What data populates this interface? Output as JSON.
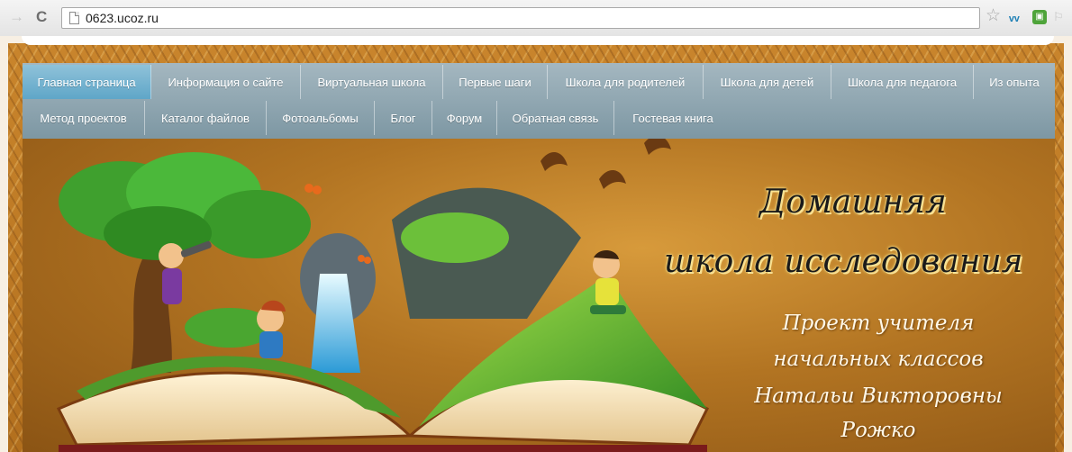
{
  "browser": {
    "url": "0623.ucoz.ru"
  },
  "menu": {
    "row1": [
      {
        "label": "Главная страница",
        "active": true
      },
      {
        "label": "Информация о сайте"
      },
      {
        "label": "Виртуальная школа"
      },
      {
        "label": "Первые шаги"
      },
      {
        "label": "Школа для родителей"
      },
      {
        "label": "Школа для детей"
      },
      {
        "label": "Школа для педагога"
      },
      {
        "label": "Из опыта"
      }
    ],
    "row2": [
      {
        "label": "Метод проектов"
      },
      {
        "label": "Каталог файлов"
      },
      {
        "label": "Фотоальбомы"
      },
      {
        "label": "Блог"
      },
      {
        "label": "Форум"
      },
      {
        "label": "Обратная связь"
      },
      {
        "label": "Гостевая книга"
      }
    ]
  },
  "banner": {
    "title_line1": "Домашняя",
    "title_line2": "школа исследования",
    "subtitle_line1": "Проект учителя",
    "subtitle_line2": "начальных классов",
    "subtitle_line3": "Натальи Викторовны",
    "subtitle_line4": "Рожко"
  },
  "colors": {
    "menu": "#8ea6b1",
    "menu_active": "#6fb0cf",
    "banner": "#b27422"
  }
}
